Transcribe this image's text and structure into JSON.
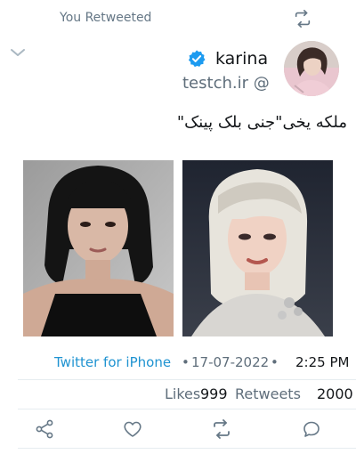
{
  "retweet_header": {
    "label": "You Retweeted",
    "icon": "retweet-icon"
  },
  "author": {
    "name": "karina",
    "handle": "testch.ir @",
    "verified": true,
    "verified_color": "#1d9bf0"
  },
  "tweet": {
    "text": "ملکه یخی\"جنی بلک پینک\""
  },
  "media": [
    {
      "icon": "photo-woman-dark-hair"
    },
    {
      "icon": "photo-woman-blonde-hair"
    }
  ],
  "meta": {
    "source": "Twitter for iPhone",
    "sep1": "•",
    "date": "17-07-2022",
    "sep2": "•",
    "time": "2:25 PM"
  },
  "stats": {
    "likes_label": "Likes",
    "likes_count": "999",
    "retweets_label": "Retweets",
    "retweets_count": "2000"
  },
  "actions": [
    {
      "icon": "share-icon"
    },
    {
      "icon": "heart-icon"
    },
    {
      "icon": "retweet-icon"
    },
    {
      "icon": "reply-icon"
    }
  ],
  "colors": {
    "link": "#1f93d1",
    "muted": "#657786",
    "accent": "#1d9bf0"
  }
}
